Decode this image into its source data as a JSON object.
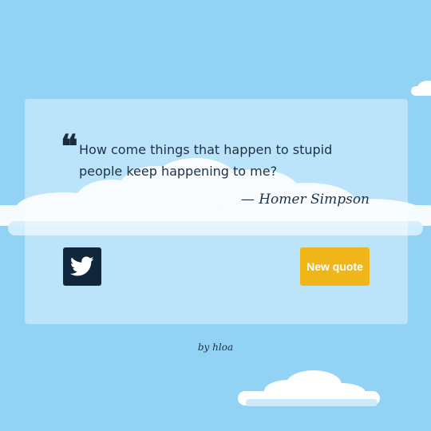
{
  "quote": {
    "text": "How come things that happen to stupid people keep happening to me?",
    "author": "— Homer Simpson"
  },
  "buttons": {
    "tweet_icon": "twitter-icon",
    "new_quote_label": "New quote"
  },
  "footer": {
    "credit": "by hloa"
  },
  "colors": {
    "background": "#92d2f5",
    "accent": "#f0b519",
    "tweet_button": "#10263c",
    "text": "#1d3144"
  }
}
